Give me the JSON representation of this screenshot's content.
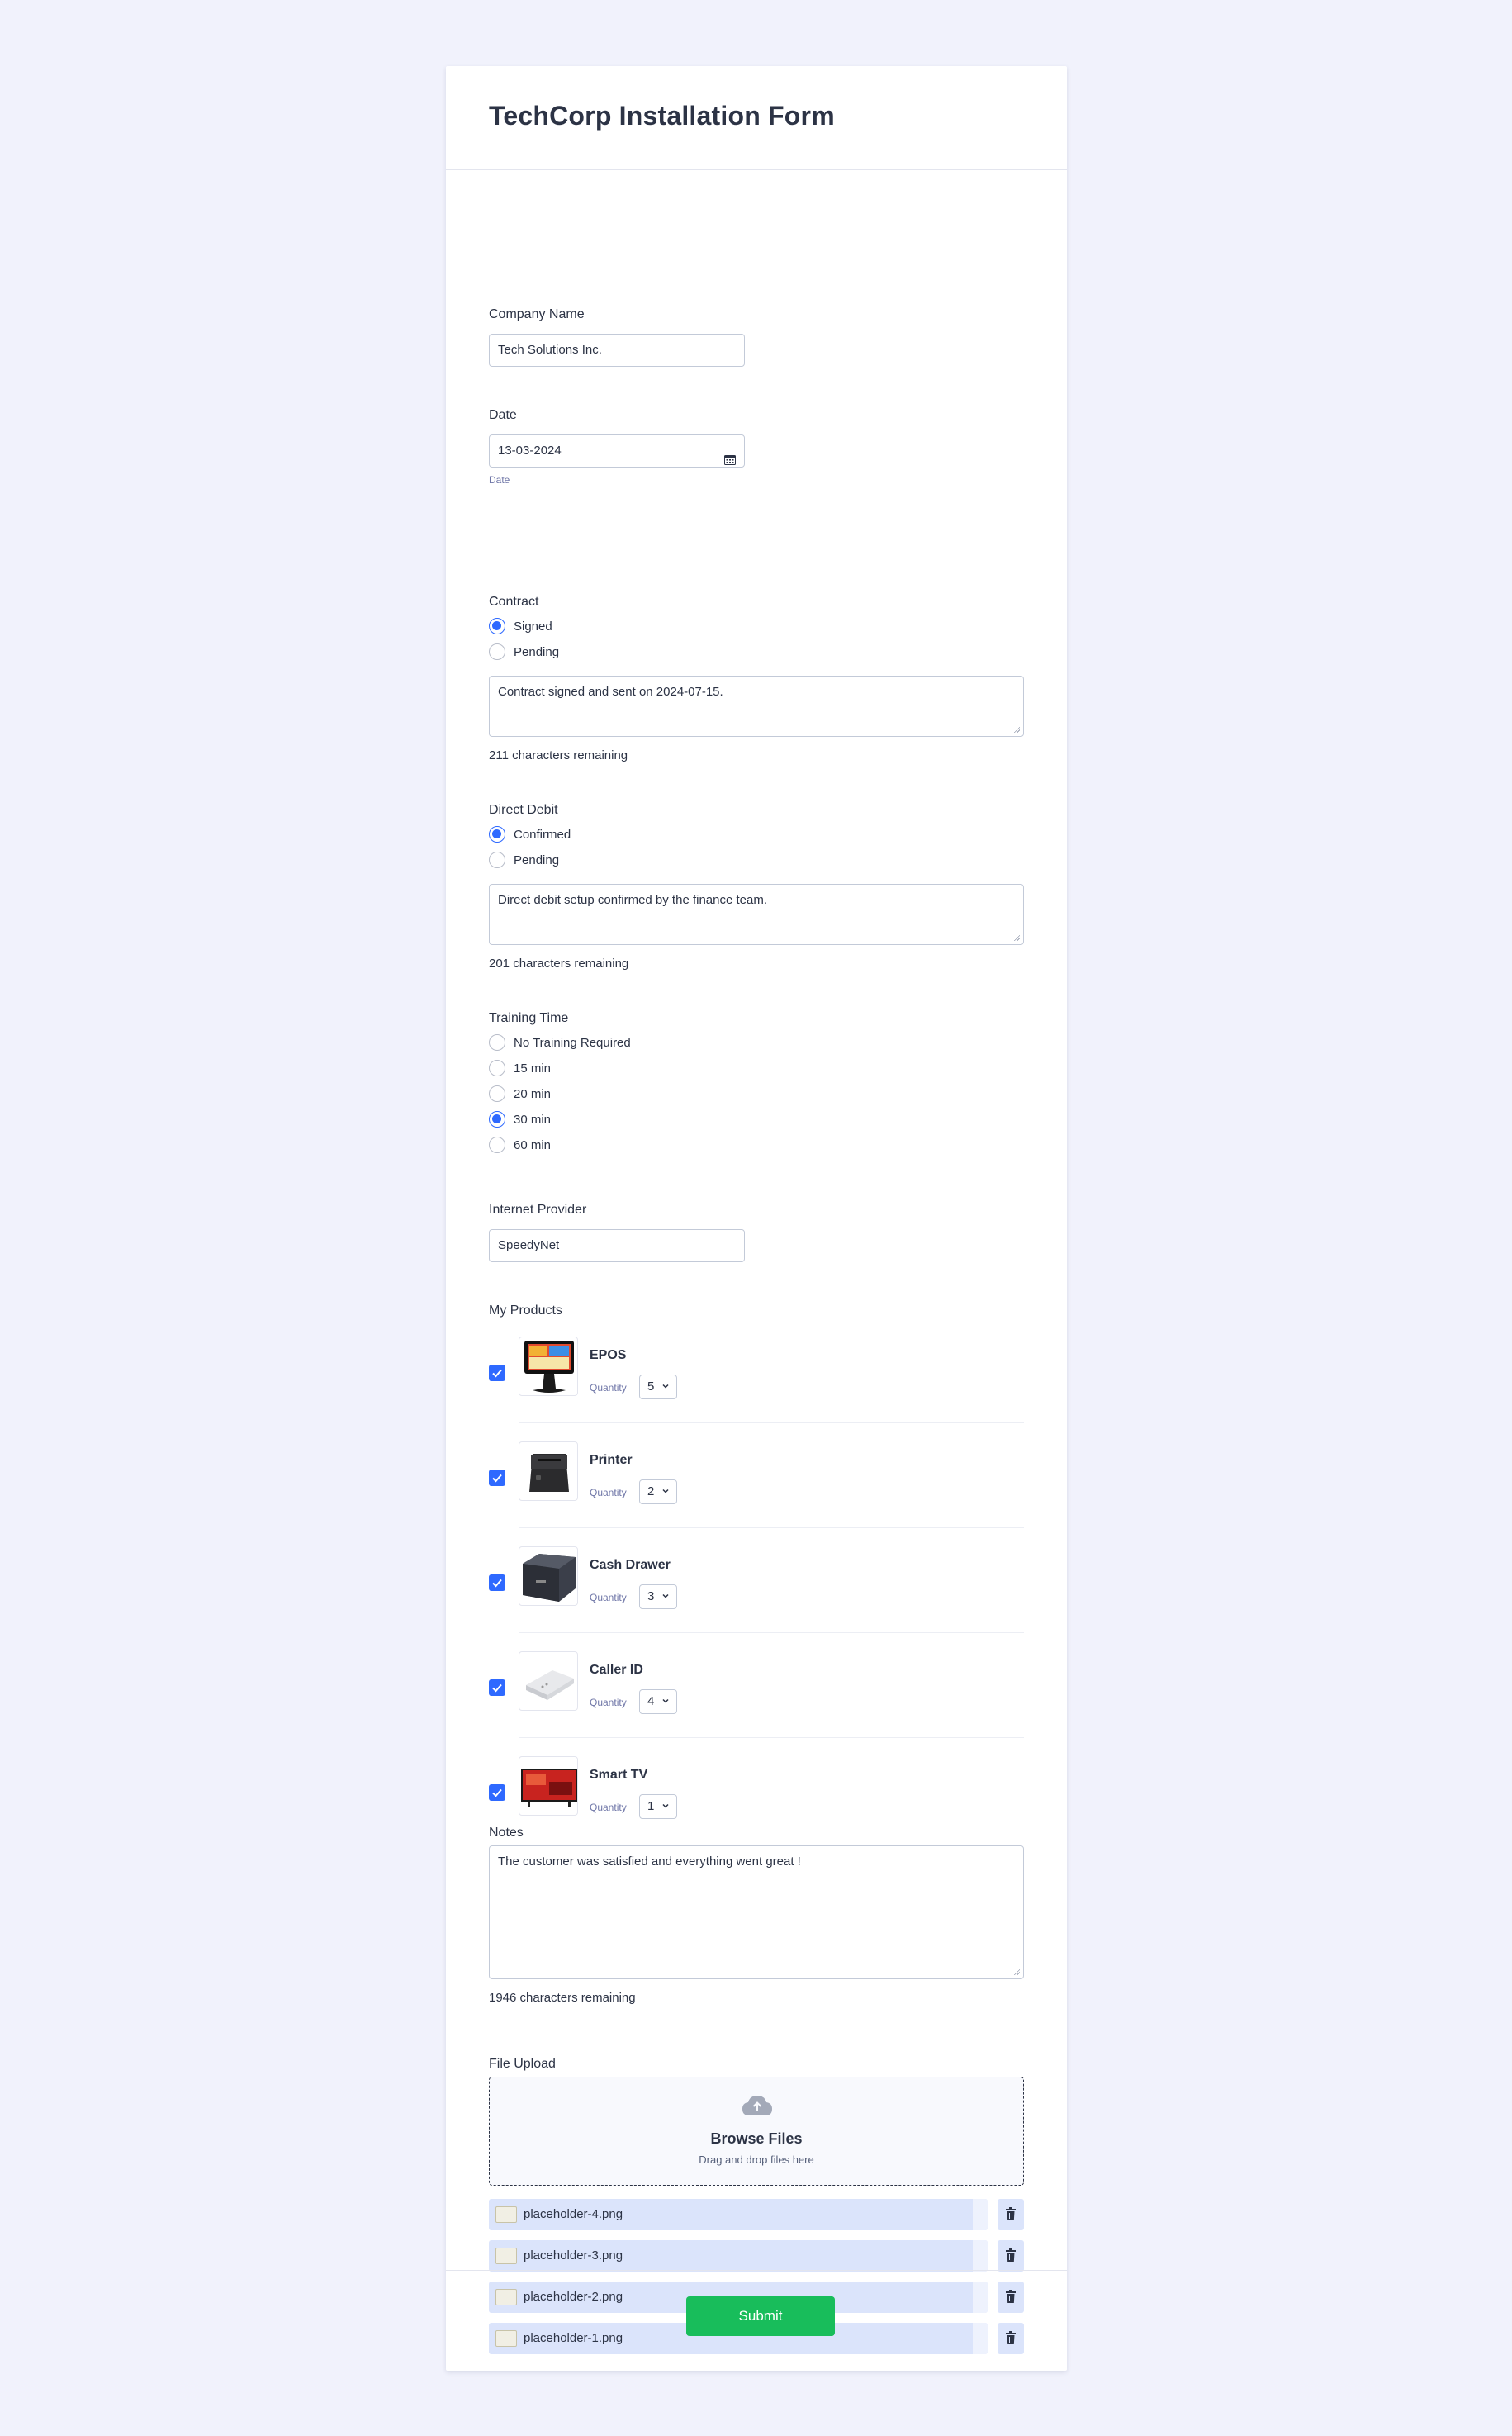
{
  "form_title": "TechCorp Installation Form",
  "company": {
    "label": "Company Name",
    "value": "Tech Solutions Inc."
  },
  "date": {
    "label": "Date",
    "value": "13-03-2024",
    "sublabel": "Date"
  },
  "contract": {
    "label": "Contract",
    "options": [
      {
        "label": "Signed",
        "selected": true
      },
      {
        "label": "Pending",
        "selected": false
      }
    ],
    "note": "Contract signed and sent on 2024-07-15.",
    "remaining": "211 characters remaining"
  },
  "direct_debit": {
    "label": "Direct Debit",
    "options": [
      {
        "label": "Confirmed",
        "selected": true
      },
      {
        "label": "Pending",
        "selected": false
      }
    ],
    "note": "Direct debit setup confirmed by the finance team.",
    "remaining": "201 characters remaining"
  },
  "training": {
    "label": "Training Time",
    "options": [
      {
        "label": "No Training Required",
        "selected": false
      },
      {
        "label": "15 min",
        "selected": false
      },
      {
        "label": "20 min",
        "selected": false
      },
      {
        "label": "30 min",
        "selected": true
      },
      {
        "label": "60 min",
        "selected": false
      }
    ]
  },
  "internet": {
    "label": "Internet Provider",
    "value": "SpeedyNet"
  },
  "products": {
    "label": "My Products",
    "quantity_label": "Quantity",
    "items": [
      {
        "name": "EPOS",
        "quantity": "5",
        "checked": true,
        "icon": "epos-terminal-icon"
      },
      {
        "name": "Printer",
        "quantity": "2",
        "checked": true,
        "icon": "receipt-printer-icon"
      },
      {
        "name": "Cash Drawer",
        "quantity": "3",
        "checked": true,
        "icon": "cash-drawer-icon"
      },
      {
        "name": "Caller ID",
        "quantity": "4",
        "checked": true,
        "icon": "caller-id-device-icon"
      },
      {
        "name": "Smart TV",
        "quantity": "1",
        "checked": true,
        "icon": "smart-tv-icon"
      }
    ]
  },
  "notes": {
    "label": "Notes",
    "value": "The customer was satisfied and everything went great !",
    "remaining": "1946 characters remaining"
  },
  "upload": {
    "label": "File Upload",
    "title": "Browse Files",
    "hint": "Drag and drop files here",
    "files": [
      "placeholder-4.png",
      "placeholder-3.png",
      "placeholder-2.png",
      "placeholder-1.png"
    ]
  },
  "submit_label": "Submit",
  "colors": {
    "accent": "#2e69ff",
    "submit": "#18bd5b",
    "page_bg": "#f1f2fc",
    "file_bar": "#dbe4fb"
  }
}
